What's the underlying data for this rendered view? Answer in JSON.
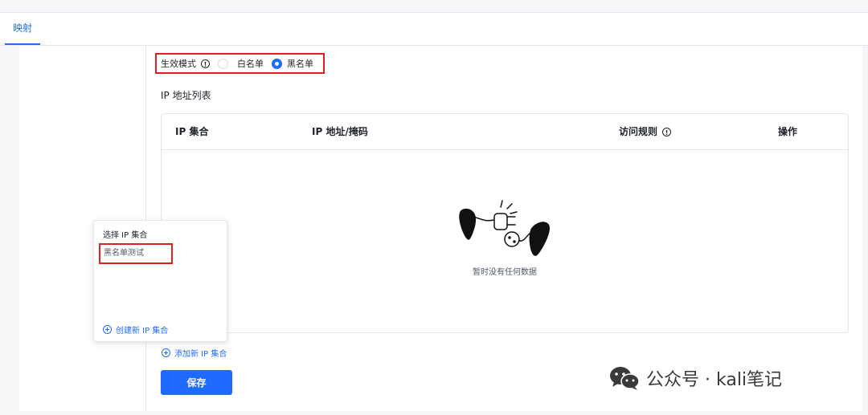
{
  "tabs": [
    {
      "label": "映射",
      "active": true
    }
  ],
  "mode": {
    "label": "生效模式",
    "options": [
      {
        "label": "白名单",
        "selected": false
      },
      {
        "label": "黑名单",
        "selected": true
      }
    ]
  },
  "ip_list": {
    "title": "IP 地址列表",
    "columns": [
      "IP 集合",
      "IP 地址/掩码",
      "访问规则",
      "操作"
    ],
    "rows": [],
    "empty_text": "暂时没有任何数据"
  },
  "dropdown": {
    "title": "选择 IP 集合",
    "items": [
      "黑名单测试"
    ],
    "create_label": "创建新 IP 集合"
  },
  "add_link": "添加新 IP 集合",
  "save_label": "保存",
  "watermark": "公众号 · kali笔记",
  "colors": {
    "accent": "#1f6bff",
    "highlight": "#e02020"
  }
}
